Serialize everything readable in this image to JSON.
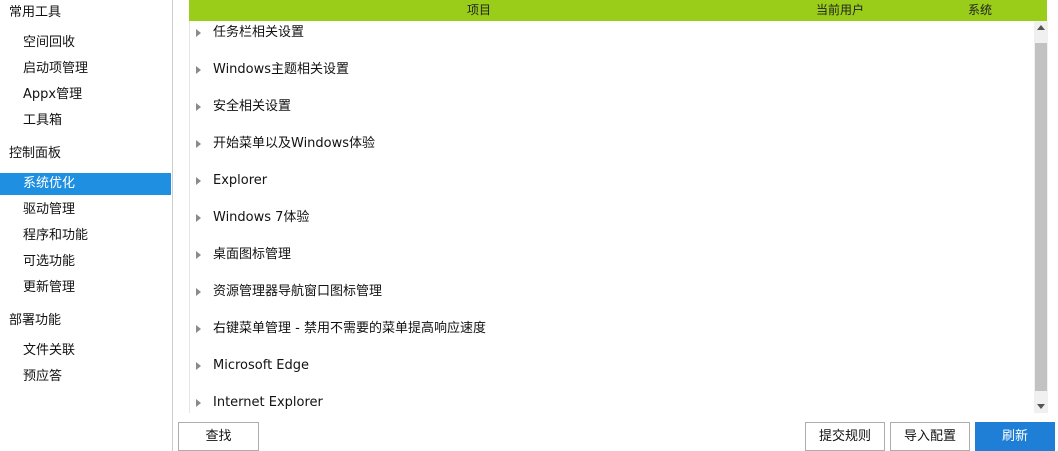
{
  "sidebar": {
    "groups": [
      {
        "title": "常用工具",
        "items": [
          "空间回收",
          "启动项管理",
          "Appx管理",
          "工具箱"
        ]
      },
      {
        "title": "控制面板",
        "items": [
          "系统优化",
          "驱动管理",
          "程序和功能",
          "可选功能",
          "更新管理"
        ]
      },
      {
        "title": "部署功能",
        "items": [
          "文件关联",
          "预应答"
        ]
      }
    ],
    "active_item": "系统优化"
  },
  "table": {
    "columns": [
      "项目",
      "当前用户",
      "系统"
    ],
    "rows": [
      "任务栏相关设置",
      "Windows主题相关设置",
      "安全相关设置",
      "开始菜单以及Windows体验",
      "Explorer",
      "Windows 7体验",
      "桌面图标管理",
      "资源管理器导航窗口图标管理",
      "右键菜单管理 - 禁用不需要的菜单提高响应速度",
      "Microsoft Edge",
      "Internet Explorer"
    ]
  },
  "buttons": {
    "find": "查找",
    "submit_rules": "提交规则",
    "import_config": "导入配置",
    "refresh": "刷新"
  },
  "colors": {
    "header_bg": "#9acd1a",
    "accent": "#1e8fe1"
  }
}
